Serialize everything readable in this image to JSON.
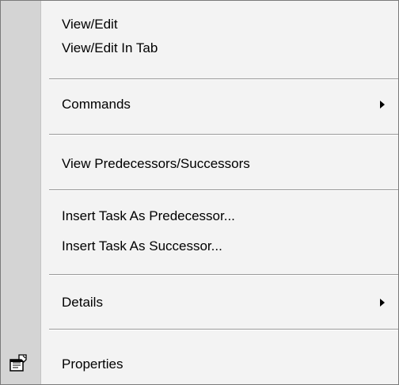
{
  "menu": {
    "items": [
      {
        "label": "View/Edit"
      },
      {
        "label": "View/Edit In Tab"
      },
      {
        "label": "Commands",
        "submenu": true
      },
      {
        "label": "View Predecessors/Successors"
      },
      {
        "label": "Insert Task As Predecessor..."
      },
      {
        "label": "Insert Task As Successor..."
      },
      {
        "label": "Details",
        "submenu": true
      },
      {
        "label": "Properties",
        "icon": "properties-icon"
      }
    ]
  }
}
